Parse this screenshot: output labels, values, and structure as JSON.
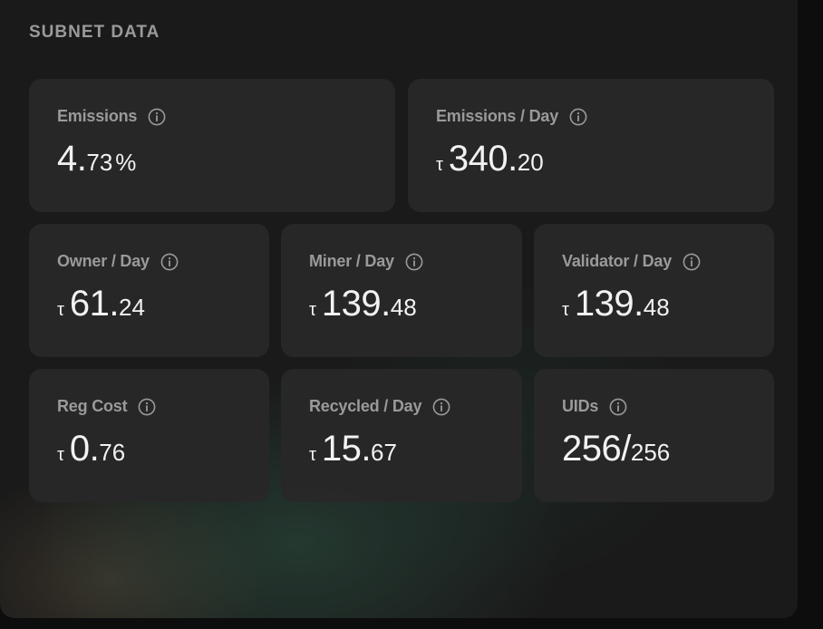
{
  "section": {
    "title": "SUBNET DATA"
  },
  "cards": [
    {
      "label": "Emissions",
      "prefix": "",
      "whole": "4.",
      "fraction": "73",
      "suffix": "%"
    },
    {
      "label": "Emissions / Day",
      "prefix": "τ",
      "whole": "340.",
      "fraction": "20",
      "suffix": ""
    },
    {
      "label": "Owner / Day",
      "prefix": "τ",
      "whole": "61.",
      "fraction": "24",
      "suffix": ""
    },
    {
      "label": "Miner / Day",
      "prefix": "τ",
      "whole": "139.",
      "fraction": "48",
      "suffix": ""
    },
    {
      "label": "Validator / Day",
      "prefix": "τ",
      "whole": "139.",
      "fraction": "48",
      "suffix": ""
    },
    {
      "label": "Reg Cost",
      "prefix": "τ",
      "whole": "0.",
      "fraction": "76",
      "suffix": ""
    },
    {
      "label": "Recycled / Day",
      "prefix": "τ",
      "whole": "15.",
      "fraction": "67",
      "suffix": ""
    },
    {
      "label": "UIDs",
      "prefix": "",
      "whole": "256/",
      "fraction": "256",
      "suffix": ""
    }
  ],
  "icons": {
    "info": "info-circle-icon"
  },
  "colors": {
    "card_bg": "#282828",
    "label": "#9a9a9a",
    "value": "#f2f2f2",
    "panel_bg": "#1a1a1a"
  }
}
